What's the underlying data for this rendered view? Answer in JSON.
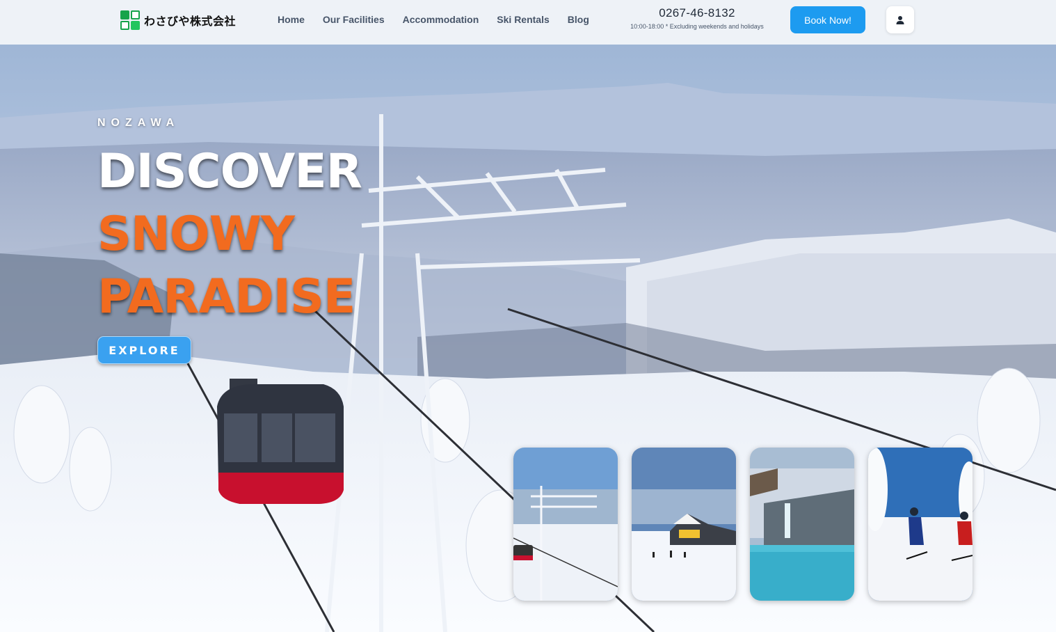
{
  "brand": {
    "name": "わさびや株式会社"
  },
  "nav": {
    "items": [
      "Home",
      "Our Facilities",
      "Accommodation",
      "Ski Rentals",
      "Blog"
    ]
  },
  "contact": {
    "phone": "0267-46-8132",
    "hours": "10:00-18:00 * Excluding weekends and holidays"
  },
  "header": {
    "book_label": "Book Now!",
    "user_icon": "user-icon"
  },
  "hero": {
    "kicker": "NOZAWA",
    "line1": "DISCOVER",
    "line2": "SNOWY",
    "line3": "PARADISE",
    "cta_label": "EXPLORE",
    "background": "snowy-gondola-mountain-landscape"
  },
  "gallery": {
    "items": [
      "gondola-lift-photo",
      "ski-lodge-photo",
      "onsen-hot-spring-photo",
      "skiers-photo"
    ]
  },
  "colors": {
    "accent_orange": "#f26b1f",
    "primary_blue": "#1d9bf0",
    "header_bg": "#eef2f7",
    "nav_text": "#475569"
  }
}
